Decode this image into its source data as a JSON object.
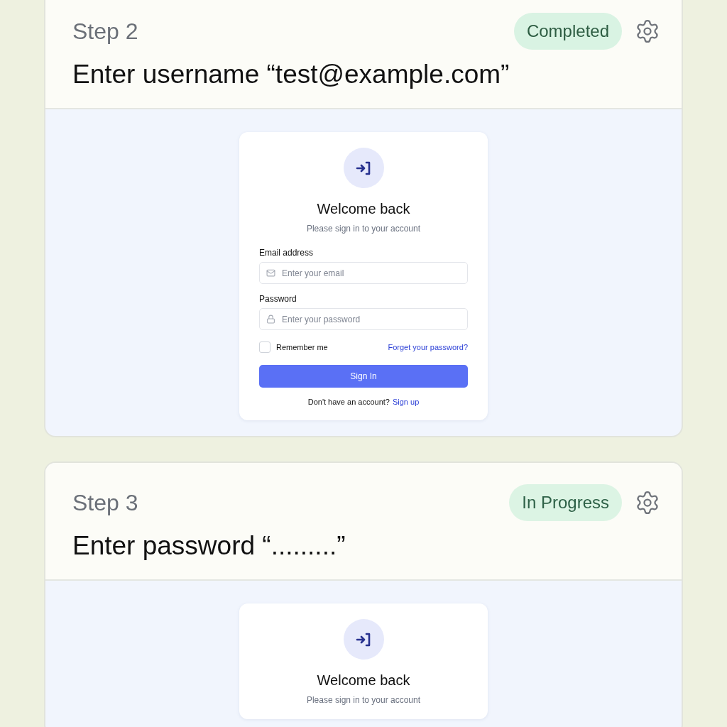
{
  "steps": [
    {
      "step": "Step 2",
      "title": "Enter username “test@example.com”",
      "status": {
        "label": "Completed",
        "kind": "completed"
      },
      "login": {
        "title": "Welcome back",
        "subtitle": "Please sign in to your account",
        "fields": [
          {
            "label": "Email address",
            "placeholder": "Enter your email",
            "kind": "email"
          },
          {
            "label": "Password",
            "placeholder": "Enter your password",
            "kind": "password"
          }
        ],
        "remember": {
          "label": "Remember me",
          "checked": false
        },
        "forgot": "Forget your password?",
        "submit": "Sign In",
        "footer": {
          "text": "Don't have an account?",
          "link": "Sign up"
        }
      }
    },
    {
      "step": "Step 3",
      "title": "Enter password “.........”",
      "status": {
        "label": "In Progress",
        "kind": "in_progress"
      },
      "login": {
        "title": "Welcome back",
        "subtitle": "Please sign in to your account"
      }
    }
  ]
}
